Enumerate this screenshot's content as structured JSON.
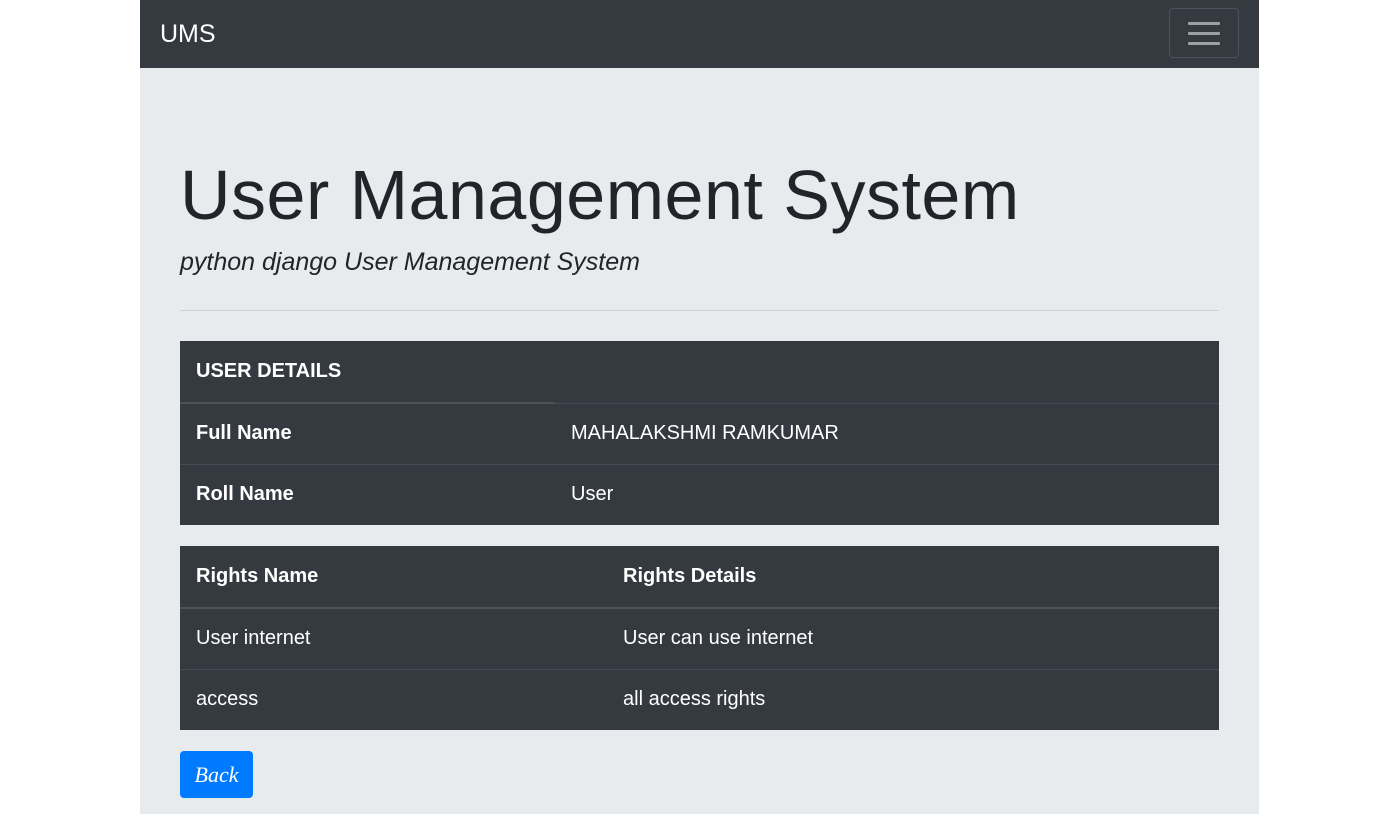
{
  "navbar": {
    "brand": "UMS",
    "toggler_icon": "hamburger-menu-icon"
  },
  "header": {
    "title": "User Management System",
    "subtitle": "python django User Management System"
  },
  "user_details": {
    "heading": "USER DETAILS",
    "rows": [
      {
        "label": "Full Name",
        "value": "MAHALAKSHMI RAMKUMAR"
      },
      {
        "label": "Roll Name",
        "value": "User"
      }
    ]
  },
  "rights": {
    "headers": [
      "Rights Name",
      "Rights Details"
    ],
    "rows": [
      {
        "name": "User internet",
        "details": "User can use internet"
      },
      {
        "name": "access",
        "details": "all access rights"
      }
    ]
  },
  "actions": {
    "back_label": "Back"
  },
  "colors": {
    "navbar_bg": "#343a40",
    "page_bg": "#e8ebee",
    "table_bg": "#343a40",
    "primary": "#007bff"
  }
}
